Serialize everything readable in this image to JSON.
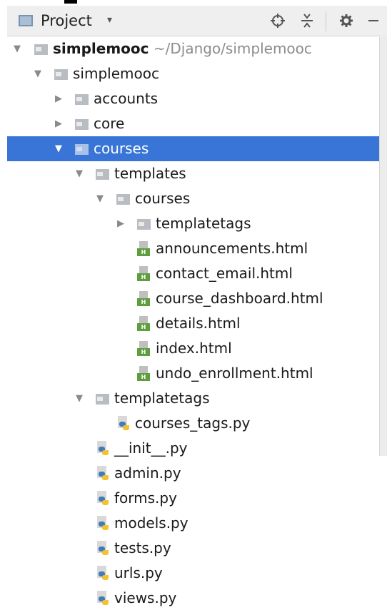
{
  "header": {
    "title": "Project",
    "caret": "▾",
    "locate_icon": "crosshair-icon",
    "collapse_icon": "collapse-all-icon",
    "settings_icon": "gear-icon",
    "hide_icon": "minus-icon"
  },
  "tree": {
    "root": {
      "name": "simplemooc",
      "path": "~/Django/simplemooc"
    },
    "items": [
      {
        "label": "simplemooc",
        "kind": "folder",
        "expanded": true
      },
      {
        "label": "accounts",
        "kind": "folder",
        "expanded": false
      },
      {
        "label": "core",
        "kind": "folder",
        "expanded": false
      },
      {
        "label": "courses",
        "kind": "folder",
        "expanded": true,
        "selected": true
      },
      {
        "label": "templates",
        "kind": "folder",
        "expanded": true
      },
      {
        "label": "courses",
        "kind": "folder",
        "expanded": true
      },
      {
        "label": "templatetags",
        "kind": "folder",
        "expanded": false
      },
      {
        "label": "announcements.html",
        "kind": "html"
      },
      {
        "label": "contact_email.html",
        "kind": "html"
      },
      {
        "label": "course_dashboard.html",
        "kind": "html"
      },
      {
        "label": "details.html",
        "kind": "html"
      },
      {
        "label": "index.html",
        "kind": "html"
      },
      {
        "label": "undo_enrollment.html",
        "kind": "html"
      },
      {
        "label": "templatetags",
        "kind": "folder",
        "expanded": true
      },
      {
        "label": "courses_tags.py",
        "kind": "py"
      },
      {
        "label": "__init__.py",
        "kind": "py"
      },
      {
        "label": "admin.py",
        "kind": "py"
      },
      {
        "label": "forms.py",
        "kind": "py"
      },
      {
        "label": "models.py",
        "kind": "py"
      },
      {
        "label": "tests.py",
        "kind": "py"
      },
      {
        "label": "urls.py",
        "kind": "py"
      },
      {
        "label": "views.py",
        "kind": "py"
      }
    ]
  },
  "colors": {
    "selection": "#3875d7",
    "header_bg": "#efefef",
    "html_badge": "#5f9e3f",
    "python_blue": "#3f7cb8",
    "python_yellow": "#f2c230"
  }
}
